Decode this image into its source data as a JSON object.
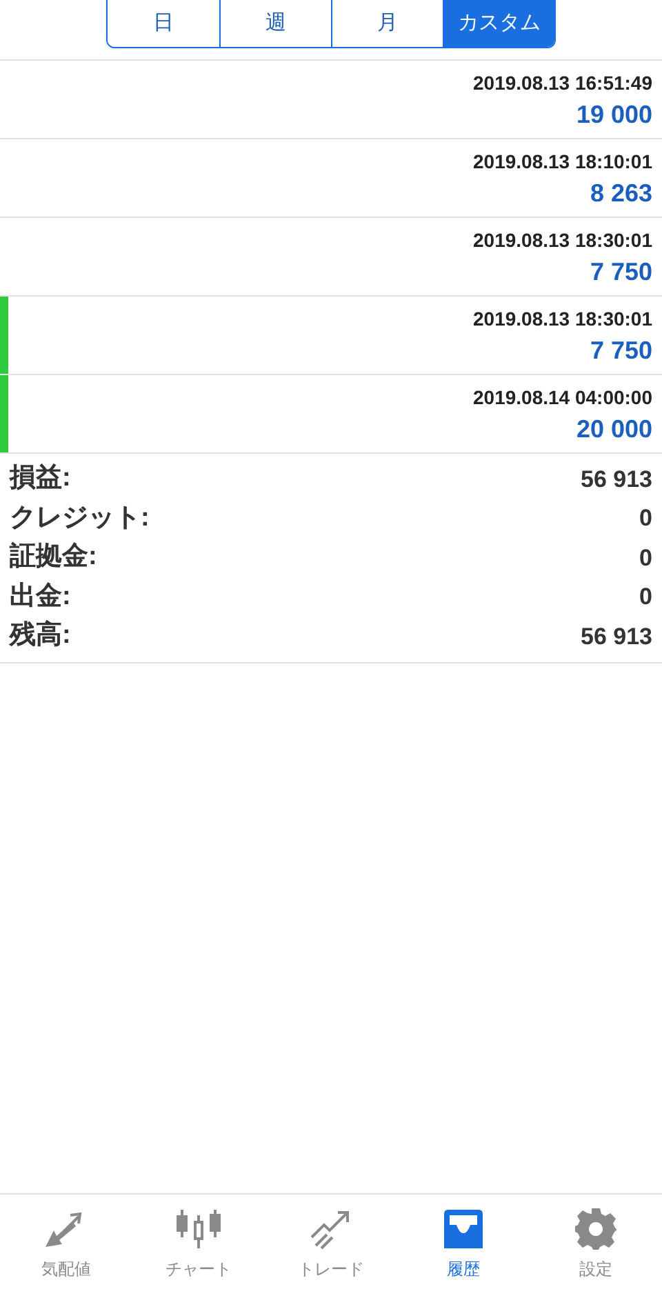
{
  "period_tabs": [
    {
      "label": "日",
      "selected": false
    },
    {
      "label": "週",
      "selected": false
    },
    {
      "label": "月",
      "selected": false
    },
    {
      "label": "カスタム",
      "selected": true
    }
  ],
  "deals": [
    {
      "time": "2019.08.13 16:51:49",
      "amount": "19 000"
    },
    {
      "time": "2019.08.13 18:10:01",
      "amount": "8 263"
    },
    {
      "time": "2019.08.13 18:30:01",
      "amount": "7 750"
    },
    {
      "time": "2019.08.13 18:30:01",
      "amount": "7 750",
      "color": "#2ecc40"
    },
    {
      "time": "2019.08.14 04:00:00",
      "amount": "20 000",
      "color": "#2ecc40"
    }
  ],
  "summary": [
    {
      "label": "損益:",
      "value": "56 913"
    },
    {
      "label": "クレジット:",
      "value": "0"
    },
    {
      "label": "証拠金:",
      "value": "0"
    },
    {
      "label": "出金:",
      "value": "0"
    },
    {
      "label": "残高:",
      "value": "56 913"
    }
  ],
  "bottom_nav": [
    {
      "kind": "quotes",
      "label": "気配値",
      "selected": false
    },
    {
      "kind": "chart",
      "label": "チャート",
      "selected": false
    },
    {
      "kind": "trade",
      "label": "トレード",
      "selected": false
    },
    {
      "kind": "history",
      "label": "履歴",
      "selected": true
    },
    {
      "kind": "settings",
      "label": "設定",
      "selected": false
    }
  ]
}
